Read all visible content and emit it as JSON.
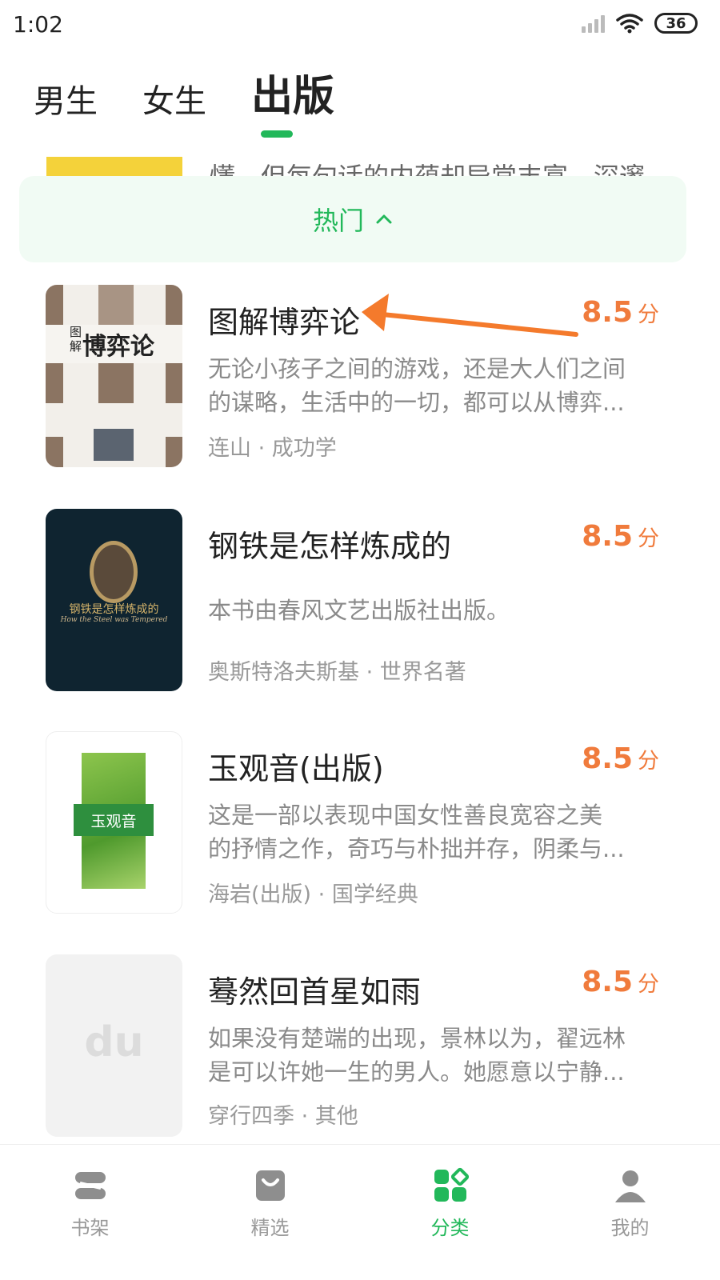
{
  "status_bar": {
    "time": "1:02",
    "battery": "36"
  },
  "tabs": [
    {
      "label": "男生",
      "active": false
    },
    {
      "label": "女生",
      "active": false
    },
    {
      "label": "出版",
      "active": true
    }
  ],
  "filter": {
    "label": "热门"
  },
  "peek_row": {
    "text": "懂，但每句话的内蕴却异常丰富，深邃"
  },
  "books": [
    {
      "title": "图解博弈论",
      "score": "8.5",
      "score_unit": "分",
      "desc_line1": "无论小孩子之间的游戏，还是大人们之间",
      "desc_line2": "的谋略，生活中的一切，都可以从博弈...",
      "meta": "连山 · 成功学",
      "cover_title": "博弈论",
      "cover_small": "图解"
    },
    {
      "title": "钢铁是怎样炼成的",
      "score": "8.5",
      "score_unit": "分",
      "desc_line1": "本书由春风文艺出版社出版。",
      "desc_line2": "",
      "meta": "奥斯特洛夫斯基 · 世界名著",
      "cover_title": "钢铁是怎样炼成的",
      "cover_sub": "How the Steel was Tempered"
    },
    {
      "title": "玉观音(出版)",
      "score": "8.5",
      "score_unit": "分",
      "desc_line1": "这是一部以表现中国女性善良宽容之美",
      "desc_line2": "的抒情之作，奇巧与朴拙并存，阴柔与...",
      "meta": "海岩(出版) · 国学经典",
      "cover_title": "玉观音"
    },
    {
      "title": "蓦然回首星如雨",
      "score": "8.5",
      "score_unit": "分",
      "desc_line1": "如果没有楚端的出现，景林以为，翟远林",
      "desc_line2": "是可以许她一生的男人。她愿意以宁静...",
      "meta": "穿行四季 · 其他",
      "cover_title": "du"
    }
  ],
  "bottom_nav": [
    {
      "label": "书架",
      "icon": "bookshelf-icon",
      "active": false
    },
    {
      "label": "精选",
      "icon": "featured-bag-icon",
      "active": false
    },
    {
      "label": "分类",
      "icon": "category-grid-icon",
      "active": true
    },
    {
      "label": "我的",
      "icon": "profile-icon",
      "active": false
    }
  ],
  "colors": {
    "accent": "#22b85a",
    "score": "#f07b3c",
    "arrow": "#f47a2c"
  }
}
